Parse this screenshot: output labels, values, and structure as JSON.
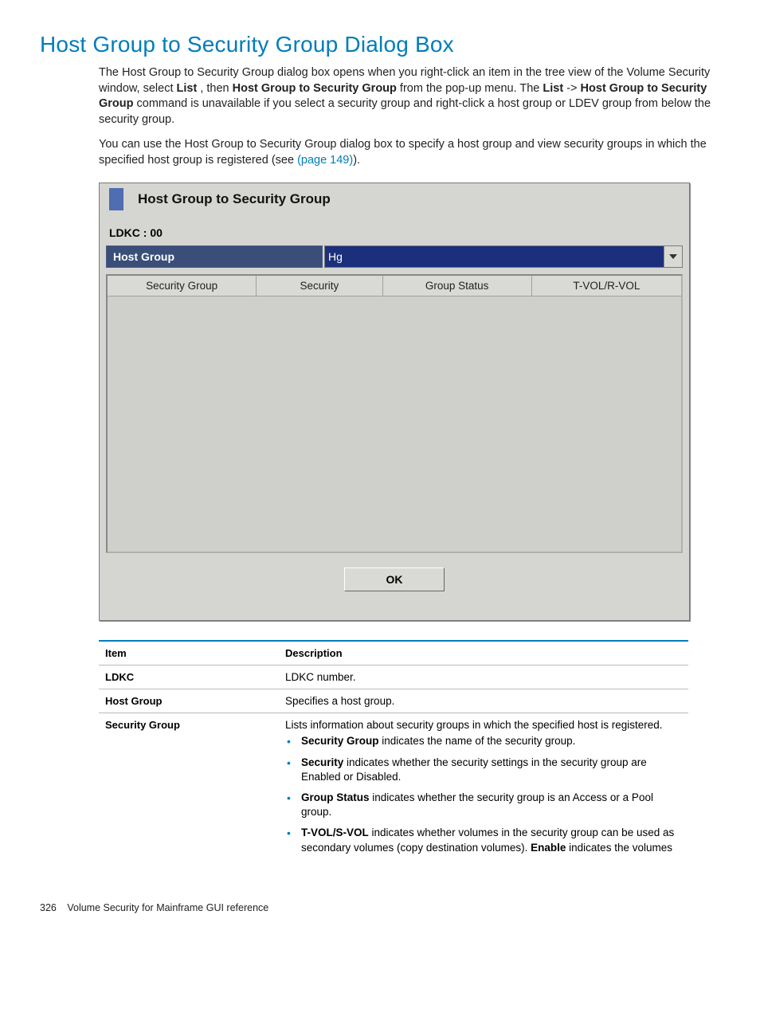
{
  "heading": "Host Group to Security Group Dialog Box",
  "para1_a": "The Host Group to Security Group dialog box opens when you right-click an item in the tree view of the Volume Security window, select ",
  "para1_b": "List",
  "para1_c": " , then ",
  "para1_d": "Host Group to Security Group",
  "para1_e": " from the pop-up menu. The ",
  "para1_f": "List",
  "para1_g": "  -> ",
  "para1_h": "Host Group to Security Group",
  "para1_i": " command is unavailable if you select a security group and right-click a host group or LDEV group from below the security group.",
  "para2_a": "You can use the Host Group to Security Group dialog box to specify a host group and view security groups in which the specified host group is registered (see ",
  "para2_link": "(page 149)",
  "para2_b": ").",
  "dialog": {
    "title": "Host Group to Security Group",
    "ldkc": "LDKC : 00",
    "host_group_label": "Host Group",
    "host_group_value": "Hg",
    "columns": {
      "c0": "Security Group",
      "c1": "Security",
      "c2": "Group Status",
      "c3": "T-VOL/R-VOL"
    },
    "ok": "OK"
  },
  "desc": {
    "h_item": "Item",
    "h_desc": "Description",
    "r0_item": "LDKC",
    "r0_desc": "LDKC number.",
    "r1_item": "Host Group",
    "r1_desc": "Specifies a host group.",
    "r2_item": "Security Group",
    "r2_intro": "Lists information about security groups in which the specified host is registered.",
    "r2_b0_a": "Security Group",
    "r2_b0_b": " indicates the name of the security group.",
    "r2_b1_a": "Security",
    "r2_b1_b": " indicates whether the security settings in the security group are Enabled or Disabled.",
    "r2_b2_a": "Group Status",
    "r2_b2_b": " indicates whether the security group is an Access or a Pool group.",
    "r2_b3_a": "T-VOL/S-VOL",
    "r2_b3_b": " indicates whether volumes in the security group can be used as secondary volumes (copy destination volumes). ",
    "r2_b3_c": "Enable",
    "r2_b3_d": " indicates the volumes"
  },
  "footer": {
    "page": "326",
    "text": "Volume Security for Mainframe GUI reference"
  }
}
